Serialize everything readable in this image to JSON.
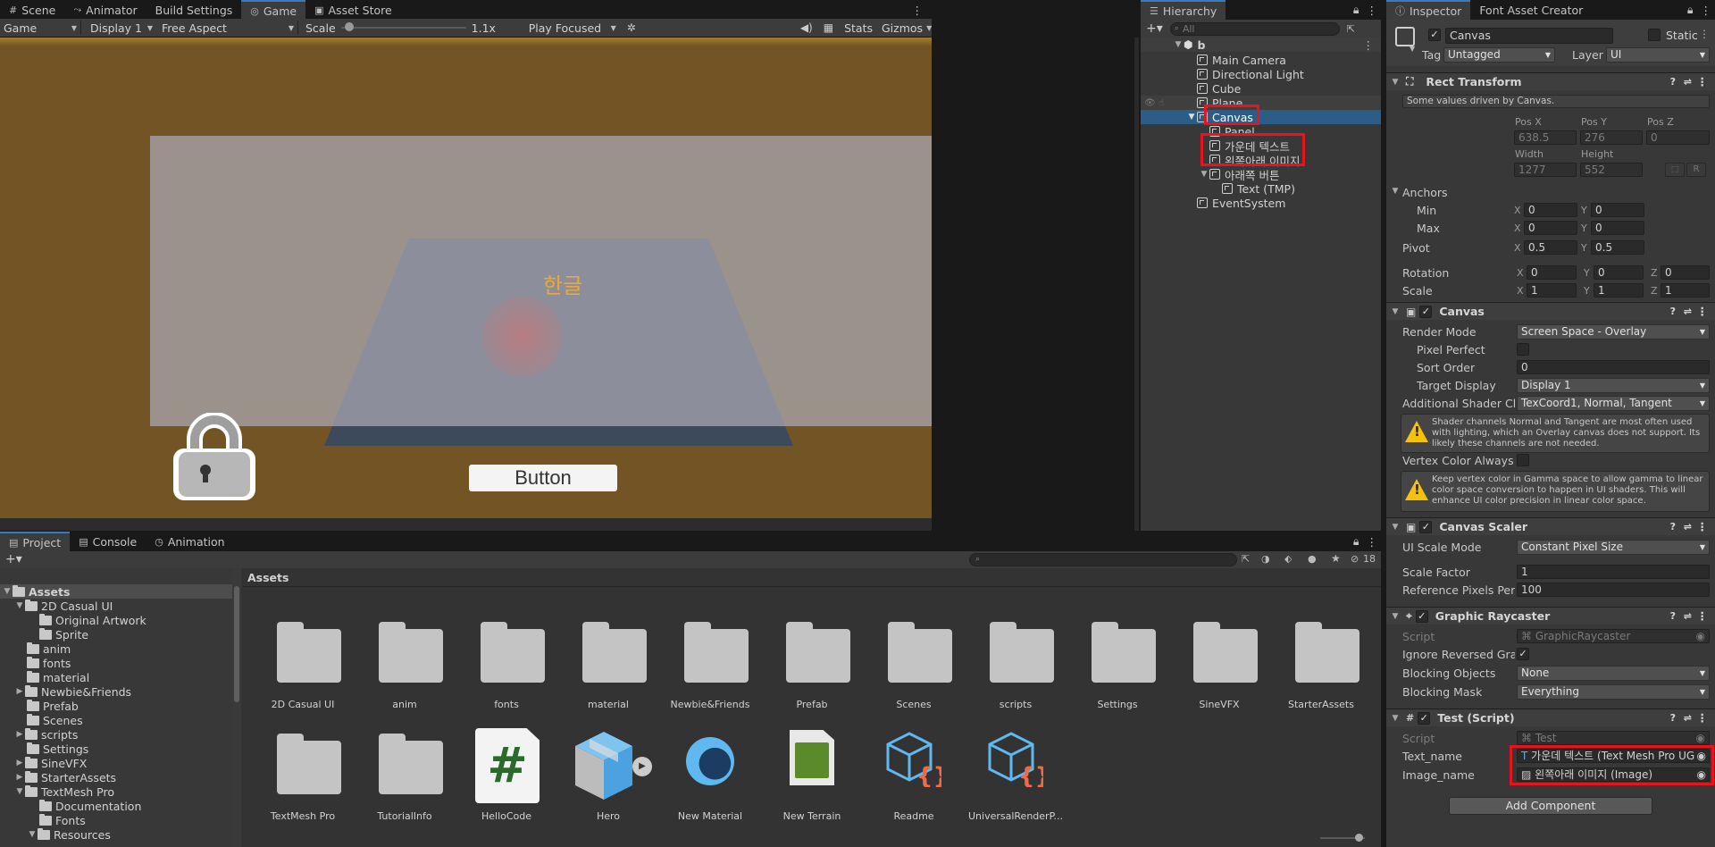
{
  "game_tabs": {
    "scene": "Scene",
    "animator": "Animator",
    "build_settings": "Build Settings",
    "game": "Game",
    "asset_store": "Asset Store"
  },
  "game_toolbar": {
    "mode": "Game",
    "display": "Display 1",
    "aspect": "Free Aspect",
    "scale_label": "Scale",
    "scale_value": "1.1x",
    "play_mode": "Play Focused",
    "stats": "Stats",
    "gizmos": "Gizmos"
  },
  "game_view": {
    "korean_text": "한글",
    "button_label": "Button"
  },
  "hierarchy": {
    "tab": "Hierarchy",
    "search_placeholder": "All",
    "scene_name": "b",
    "items": [
      {
        "label": "Main Camera"
      },
      {
        "label": "Directional Light"
      },
      {
        "label": "Cube"
      },
      {
        "label": "Plane"
      },
      {
        "label": "Canvas"
      },
      {
        "label": "Panel"
      },
      {
        "label": "가운데 텍스트"
      },
      {
        "label": "왼쪽아래 이미지"
      },
      {
        "label": "아래쪽 버튼"
      },
      {
        "label": "Text (TMP)"
      },
      {
        "label": "EventSystem"
      }
    ]
  },
  "inspector": {
    "tabs": [
      "Inspector",
      "Font Asset Creator"
    ],
    "object_name": "Canvas",
    "static_label": "Static",
    "tag_label": "Tag",
    "tag_value": "Untagged",
    "layer_label": "Layer",
    "layer_value": "UI",
    "rect_transform": {
      "title": "Rect Transform",
      "note": "Some values driven by Canvas.",
      "pos_x_label": "Pos X",
      "pos_y_label": "Pos Y",
      "pos_z_label": "Pos Z",
      "pos_x": "638.5",
      "pos_y": "276",
      "pos_z": "0",
      "width_label": "Width",
      "height_label": "Height",
      "width": "1277",
      "height": "552",
      "r_button": "R",
      "anchors_label": "Anchors",
      "min_label": "Min",
      "min_x": "0",
      "min_y": "0",
      "max_label": "Max",
      "max_x": "0",
      "max_y": "0",
      "pivot_label": "Pivot",
      "pivot_x": "0.5",
      "pivot_y": "0.5",
      "rotation_label": "Rotation",
      "rot_x": "0",
      "rot_y": "0",
      "rot_z": "0",
      "scale_label": "Scale",
      "scale_x": "1",
      "scale_y": "1",
      "scale_z": "1",
      "x": "X",
      "y": "Y",
      "z": "Z"
    },
    "canvas": {
      "title": "Canvas",
      "render_mode_label": "Render Mode",
      "render_mode": "Screen Space - Overlay",
      "pixel_perfect_label": "Pixel Perfect",
      "sort_order_label": "Sort Order",
      "sort_order": "0",
      "target_display_label": "Target Display",
      "target_display": "Display 1",
      "shader_channels_label": "Additional Shader Cha",
      "shader_channels": "TexCoord1, Normal, Tangent",
      "shader_warning": "Shader channels Normal and Tangent are most often used with lighting, which an Overlay canvas does not support. Its likely these channels are not needed.",
      "vertex_color_label": "Vertex Color Always In",
      "vertex_warning": "Keep vertex color in Gamma space to allow gamma to linear color space conversion to happen in UI shaders. This will enhance UI color precision in linear color space."
    },
    "canvas_scaler": {
      "title": "Canvas Scaler",
      "ui_scale_mode_label": "UI Scale Mode",
      "ui_scale_mode": "Constant Pixel Size",
      "scale_factor_label": "Scale Factor",
      "scale_factor": "1",
      "ref_ppu_label": "Reference Pixels Per U",
      "ref_ppu": "100"
    },
    "graphic_raycaster": {
      "title": "Graphic Raycaster",
      "script_label": "Script",
      "script_value": "GraphicRaycaster",
      "ignore_reversed_label": "Ignore Reversed Grap",
      "blocking_objects_label": "Blocking Objects",
      "blocking_objects": "None",
      "blocking_mask_label": "Blocking Mask",
      "blocking_mask": "Everything"
    },
    "test_script": {
      "title": "Test (Script)",
      "script_label": "Script",
      "script_value": "Test",
      "text_name_label": "Text_name",
      "text_name_value": "가운데 텍스트 (Text Mesh Pro UG",
      "image_name_label": "Image_name",
      "image_name_value": "왼쪽아래 이미지 (Image)"
    },
    "add_component": "Add Component"
  },
  "project": {
    "tabs": [
      "Project",
      "Console",
      "Animation"
    ],
    "hidden_count": "18",
    "breadcrumb": "Assets",
    "tree": [
      {
        "label": "Assets"
      },
      {
        "label": "2D Casual UI"
      },
      {
        "label": "Original Artwork"
      },
      {
        "label": "Sprite"
      },
      {
        "label": "anim"
      },
      {
        "label": "fonts"
      },
      {
        "label": "material"
      },
      {
        "label": "Newbie&Friends"
      },
      {
        "label": "Prefab"
      },
      {
        "label": "Scenes"
      },
      {
        "label": "scripts"
      },
      {
        "label": "Settings"
      },
      {
        "label": "SineVFX"
      },
      {
        "label": "StarterAssets"
      },
      {
        "label": "TextMesh Pro"
      },
      {
        "label": "Documentation"
      },
      {
        "label": "Fonts"
      },
      {
        "label": "Resources"
      }
    ],
    "assets_row1": [
      "2D Casual UI",
      "anim",
      "fonts",
      "material",
      "Newbie&Friends",
      "Prefab",
      "Scenes",
      "scripts",
      "Settings",
      "SineVFX",
      "StarterAssets"
    ],
    "assets_row2": [
      "TextMesh Pro",
      "TutorialInfo",
      "HelloCode",
      "Hero",
      "New Material",
      "New Terrain",
      "Readme",
      "UniversalRenderP..."
    ]
  },
  "colors": {
    "accent": "#3a79bb",
    "highlight_red": "#e8141d",
    "game_bg": "#725425",
    "selection": "#2c5d87"
  }
}
